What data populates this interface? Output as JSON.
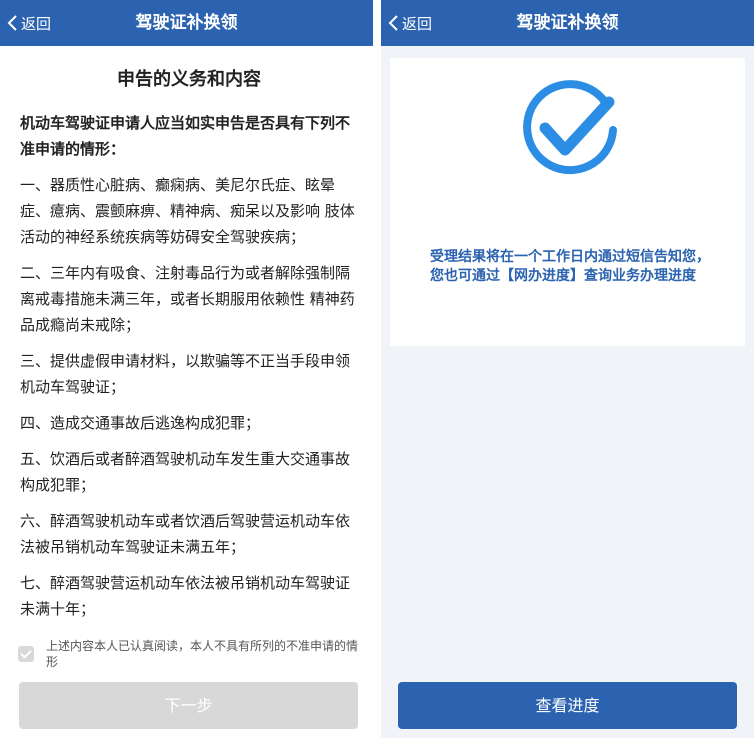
{
  "left_screen": {
    "navbar": {
      "back_label": "返回",
      "title": "驾驶证补换领"
    },
    "document": {
      "title": "申告的义务和内容",
      "intro": "机动车驾驶证申请人应当如实申告是否具有下列不准申请的情形：",
      "clauses": [
        "一、器质性心脏病、癫痫病、美尼尔氏症、眩晕症、癔病、震颤麻痹、精神病、痴呆以及影响 肢体活动的神经系统疾病等妨碍安全驾驶疾病；",
        "二、三年内有吸食、注射毒品行为或者解除强制隔离戒毒措施未满三年，或者长期服用依赖性 精神药品成瘾尚未戒除；",
        "三、提供虚假申请材料，以欺骗等不正当手段申领机动车驾驶证；",
        "四、造成交通事故后逃逸构成犯罪；",
        "五、饮酒后或者醉酒驾驶机动车发生重大交通事故构成犯罪；",
        "六、醉酒驾驶机动车或者饮酒后驾驶营运机动车依法被吊销机动车驾驶证未满五年；",
        "七、醉酒驾驶营运机动车依法被吊销机动车驾驶证未满十年；"
      ]
    },
    "agreement": {
      "text": "上述内容本人已认真阅读，本人不具有所列的不准申请的情形"
    },
    "next_button": {
      "label": "下一步"
    }
  },
  "right_screen": {
    "navbar": {
      "back_label": "返回",
      "title": "驾驶证补换领"
    },
    "result": {
      "message": "受理结果将在一个工作日内通过短信告知您，您也可通过【网办进度】查询业务办理进度"
    },
    "progress_button": {
      "label": "查看进度"
    }
  },
  "colors": {
    "brand_blue": "#2c63b0",
    "check_blue": "#2b8de4",
    "disabled_gray": "#d8d8d8",
    "page_bg": "#f0f3f7"
  }
}
